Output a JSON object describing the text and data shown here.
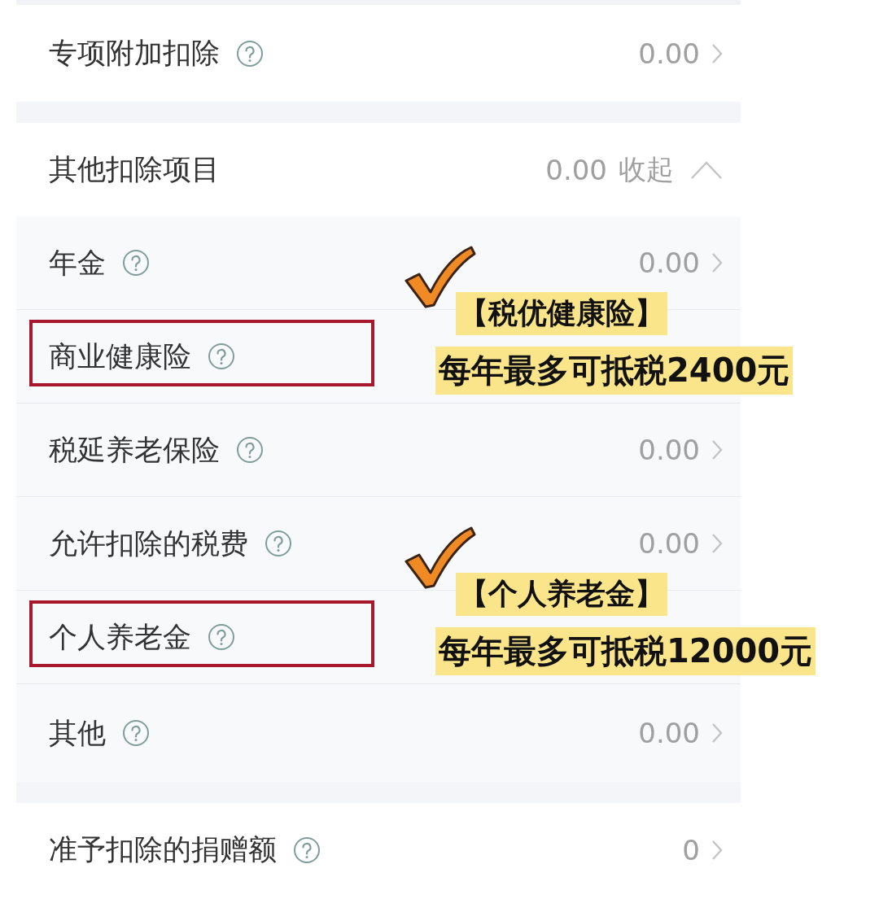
{
  "top_row": {
    "label": "专项附加扣除",
    "value": "0.00"
  },
  "other_deductions": {
    "label": "其他扣除项目",
    "value": "0.00",
    "toggle": "收起",
    "expanded": true,
    "items": [
      {
        "label": "年金",
        "value": "0.00",
        "highlighted": false
      },
      {
        "label": "商业健康险",
        "highlighted": true,
        "annotation": {
          "title": "【税优健康险】",
          "note": "每年最多可抵税2400元"
        }
      },
      {
        "label": "税延养老保险",
        "value": "0.00",
        "highlighted": false
      },
      {
        "label": "允许扣除的税费",
        "value": "0.00",
        "highlighted": false
      },
      {
        "label": "个人养老金",
        "highlighted": true,
        "annotation": {
          "title": "【个人养老金】",
          "note": "每年最多可抵税12000元"
        }
      },
      {
        "label": "其他",
        "value": "0.00",
        "highlighted": false
      }
    ]
  },
  "donation_row": {
    "label": "准予扣除的捐赠额",
    "value": "0"
  }
}
